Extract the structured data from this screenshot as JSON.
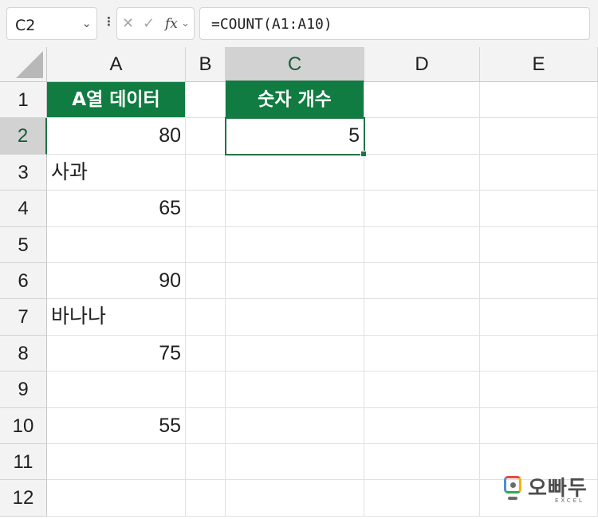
{
  "formula_bar": {
    "name_box": "C2",
    "fx_label": "fx",
    "formula": "=COUNT(A1:A10)"
  },
  "columns": [
    "A",
    "B",
    "C",
    "D",
    "E"
  ],
  "rows": [
    "1",
    "2",
    "3",
    "4",
    "5",
    "6",
    "7",
    "8",
    "9",
    "10",
    "11",
    "12"
  ],
  "cells": {
    "A1": "A열 데이터",
    "C1": "숫자 개수",
    "A2": "80",
    "C2": "5",
    "A3": "사과",
    "A4": "65",
    "A6": "90",
    "A7": "바나나",
    "A8": "75",
    "A10": "55"
  },
  "logo": {
    "word": "오빠두",
    "sub": "EXCEL"
  },
  "colors": {
    "header_fill": "#107c41",
    "selection": "#217346"
  }
}
